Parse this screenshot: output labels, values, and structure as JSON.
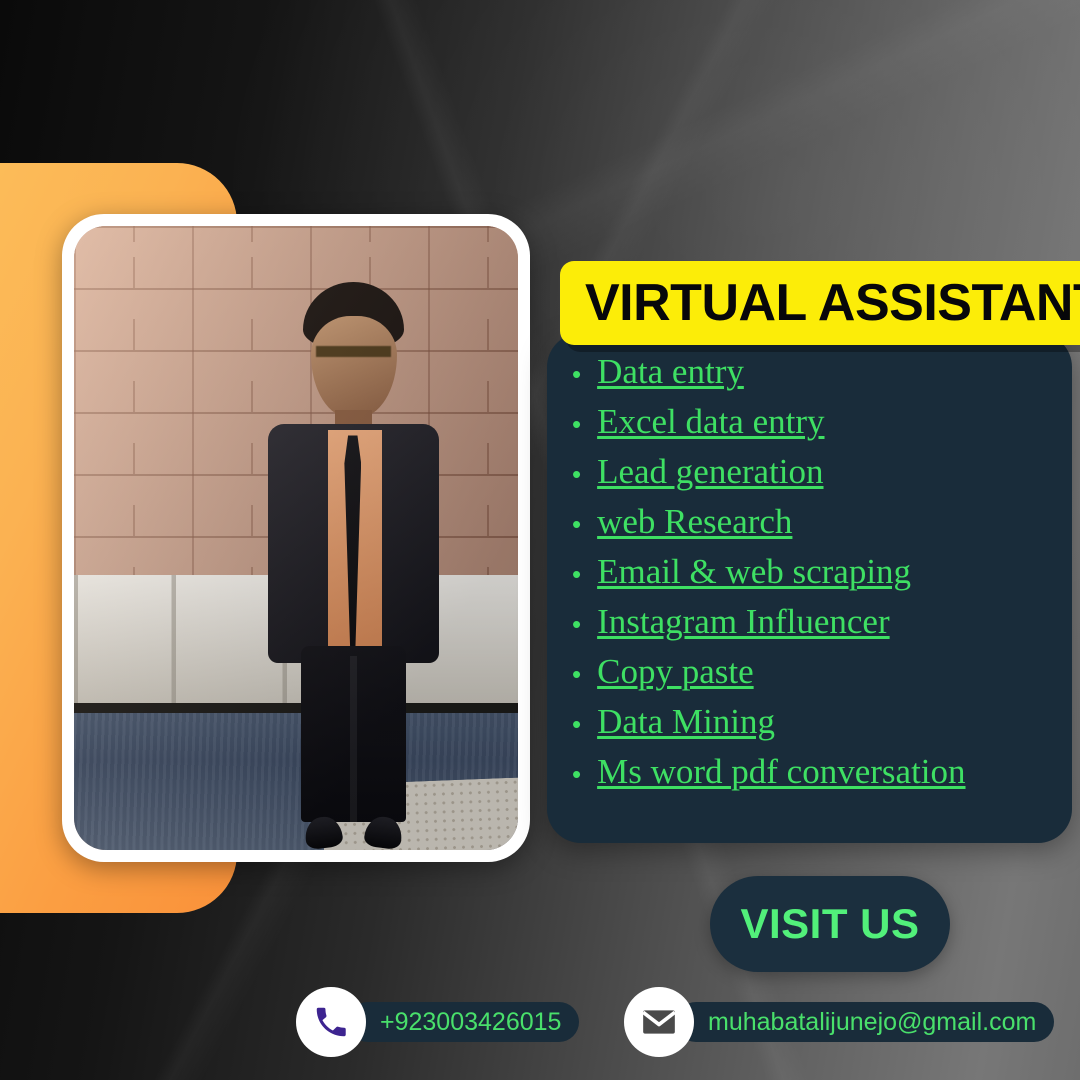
{
  "poster": {
    "title": "VIRTUAL ASSISTANT",
    "cta": "VISIT US"
  },
  "services": [
    {
      "label": "Data entry"
    },
    {
      "label": "Excel data entry"
    },
    {
      "label": "Lead generation "
    },
    {
      "label": "web Research"
    },
    {
      "label": "Email & web scraping"
    },
    {
      "label": "Instagram Influencer"
    },
    {
      "label": "Copy paste "
    },
    {
      "label": "Data Mining"
    },
    {
      "label": "Ms word pdf conversation "
    }
  ],
  "bullet_glyph": "•",
  "contact": {
    "phone": {
      "icon": "phone-icon",
      "value": "+923003426015"
    },
    "email": {
      "icon": "envelope-icon",
      "value": "muhabatalijunejo@gmail.com"
    }
  },
  "photo": {
    "alt": "man in dark suit with orange shirt and black tie standing in front of brick wall"
  },
  "colors": {
    "banner_yellow": "#fced08",
    "panel_navy": "#192c3a",
    "accent_green": "#3ee063",
    "orange": "#fbab4d",
    "phone_icon_purple": "#3d2490",
    "envelope_icon_gray": "#4a4a4a"
  }
}
